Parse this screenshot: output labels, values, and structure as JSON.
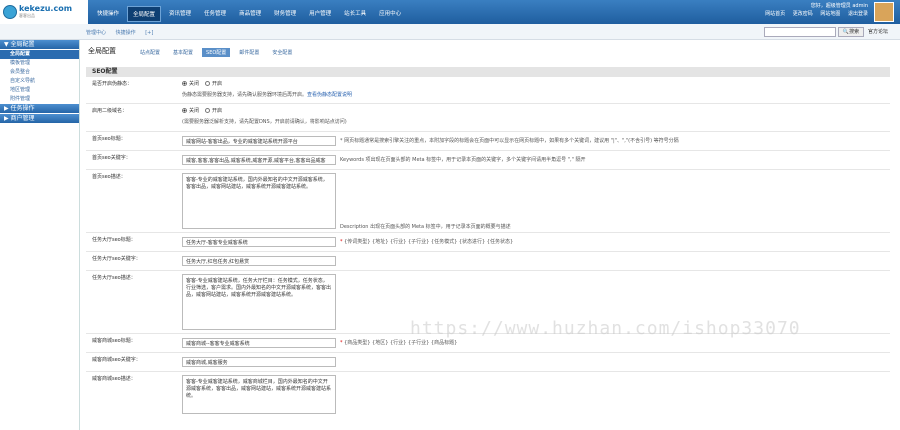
{
  "logo": {
    "text": "kekezu.com",
    "sub": "客客出品"
  },
  "nav": {
    "items": [
      "快捷操作",
      "全局配置",
      "资讯管理",
      "任务管理",
      "商品管理",
      "财务管理",
      "用户管理",
      "站长工具",
      "应用中心"
    ],
    "active_index": 1
  },
  "user": {
    "greeting": "您好，超级管理员 admin",
    "links": [
      "网站首页",
      "更改密码",
      "网站地图",
      "退出登录"
    ]
  },
  "breadcrumb": [
    "管理中心",
    "快捷操作",
    "[+]"
  ],
  "search": {
    "placeholder": "",
    "button": "搜索",
    "link": "官方论坛"
  },
  "sidebar": {
    "sections": [
      {
        "title": "全局配置",
        "items": [
          "全局配置",
          "模板管理",
          "会员整合",
          "自定义导航",
          "地区管理",
          "附件管理"
        ]
      },
      {
        "title": "任务操作",
        "items": []
      },
      {
        "title": "商户管理",
        "items": []
      }
    ],
    "active_item": "全局配置"
  },
  "page": {
    "title": "全局配置",
    "tabs": [
      "站点配置",
      "基本配置",
      "SEO配置",
      "邮件配置",
      "安全配置"
    ],
    "active_tab": 2
  },
  "section_title": "SEO配置",
  "rows": {
    "rewrite": {
      "label": "是否开启伪静态：",
      "opt_on": "关闭",
      "opt_off": "开启",
      "hint": "伪静态需要服务器支持，请先确认服务器环境后再开启。",
      "hint_link": "查看伪静态配置说明"
    },
    "domain": {
      "label": "启用二级域名：",
      "opt_on": "关闭",
      "opt_off": "开启",
      "hint": "(需要服务器泛解析支持，请先配置DNS，开启前请确认，将影响站点访问)"
    },
    "home_title": {
      "label": "首页seo标题：",
      "value": "威客网站-客客出品，专业的威客建站系统开源平台",
      "note": "* 网页标题通常是搜索引擎关注的重点，本附加字段的标题会在页面中可以显示在网页标题中，如果有多个关键词，建议用 \"|\"、\",\"(不含引号) 等符号分隔"
    },
    "home_keywords": {
      "label": "首页seo关键字：",
      "value": "威客,客客,客客出品,威客系统,威客开源,威客平台,客客出品威客",
      "note": "Keywords 项出现在页面头部的 Meta 标签中，用于记录本页面的关键字，多个关键字间请用半角逗号 \",\" 隔开"
    },
    "home_desc": {
      "label": "首页seo描述：",
      "value": "客客-专业的威客建站系统，国内外最知名的中文开源威客系统，客客出品，威客网站建站，威客系统开源威客建站系统。",
      "note": "Description 出现在页面头部的 Meta 标签中，用于记录本页面的概要与描述"
    },
    "task_title": {
      "label": "任务大厅seo标题：",
      "value": "任务大厅-客客专业威客系统",
      "note_star": "*",
      "note": "{传词类型} {地址} {行业} {子行业} {任务模式} {状态进行} {任务状态}"
    },
    "task_keywords": {
      "label": "任务大厅seo关键字：",
      "value": "任务大厅,红包任务,红包悬赏"
    },
    "task_desc": {
      "label": "任务大厅seo描述：",
      "value": "客客-专业威客建站系统，任务大厅栏目：任务模式，任务状态，行业筛选，客户需求。国内外最知名的中文开源威客系统，客客出品，威客网站建站，威客系统开源威客建站系统。"
    },
    "shop_title": {
      "label": "威客商城seo标题：",
      "value": "威客商城--客客专业威客系统",
      "note_star": "*",
      "note": "{商品类型} {地区} {行业} {子行业} {商品标题}"
    },
    "shop_keywords": {
      "label": "威客商城seo关键字：",
      "value": "威客商城,威客服务"
    },
    "shop_desc": {
      "label": "威客商城seo描述：",
      "value": "客客-专业威客建站系统，威客商城栏目，国内外最知名的中文开源威客系统，客客出品，威客网站建站，威客系统开源威客建站系统。"
    }
  },
  "watermark": "https://www.huzhan.com/ishop33070",
  "colors": {
    "topbar": "#2565a7",
    "accent": "#2b6cb0"
  }
}
